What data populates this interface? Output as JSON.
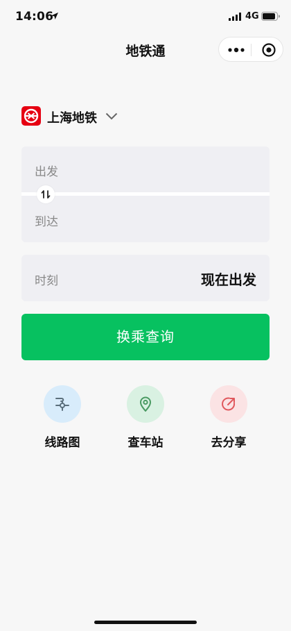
{
  "status_bar": {
    "time": "14:06",
    "network": "4G"
  },
  "nav": {
    "title": "地铁通",
    "more_icon": "more-dots-icon",
    "target_icon": "target-icon"
  },
  "city": {
    "name": "上海地铁",
    "logo_icon": "shanghai-metro-logo",
    "chevron_icon": "chevron-down-icon"
  },
  "route": {
    "from_label": "出发",
    "to_label": "到达",
    "swap_icon": "swap-icon"
  },
  "time": {
    "label": "时刻",
    "value": "现在出发"
  },
  "search_button": "换乘查询",
  "shortcuts": [
    {
      "label": "线路图",
      "icon": "line-map-icon",
      "bg": "#d8ecfb",
      "color": "#5b6f7c"
    },
    {
      "label": "查车站",
      "icon": "location-pin-icon",
      "bg": "#d9f1e2",
      "color": "#4a9a62"
    },
    {
      "label": "去分享",
      "icon": "share-icon",
      "bg": "#fbe3e4",
      "color": "#e0575c"
    }
  ],
  "colors": {
    "primary": "#07c160",
    "field_bg": "#efeff3",
    "logo_red": "#e60012"
  }
}
